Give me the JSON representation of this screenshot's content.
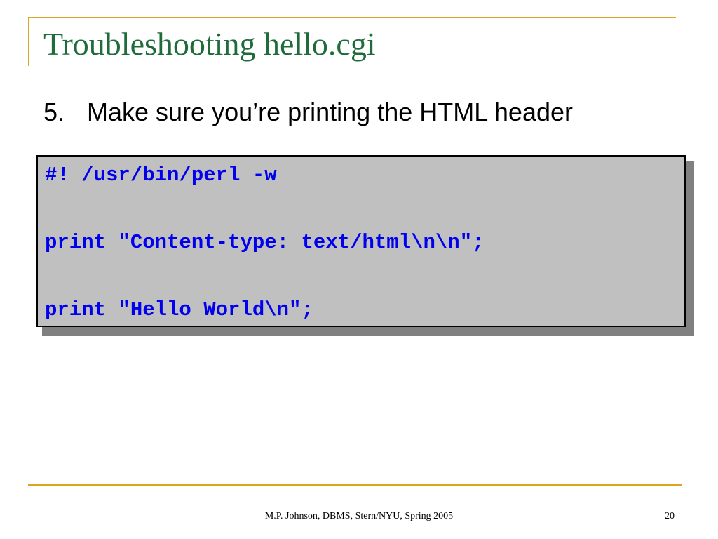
{
  "slide": {
    "title": "Troubleshooting hello.cgi",
    "bullet": {
      "number": "5.",
      "text": "Make sure you’re printing the HTML header"
    },
    "code": [
      "#! /usr/bin/perl -w",
      "print \"Content-type: text/html\\n\\n\";",
      "print \"Hello World\\n\";"
    ],
    "footer": "M.P. Johnson, DBMS, Stern/NYU, Spring 2005",
    "page_number": "20"
  },
  "colors": {
    "title": "#1F6B3A",
    "accent_rule": "#DAA520",
    "code_text": "#0000EE",
    "code_background": "#C0C0C0"
  }
}
